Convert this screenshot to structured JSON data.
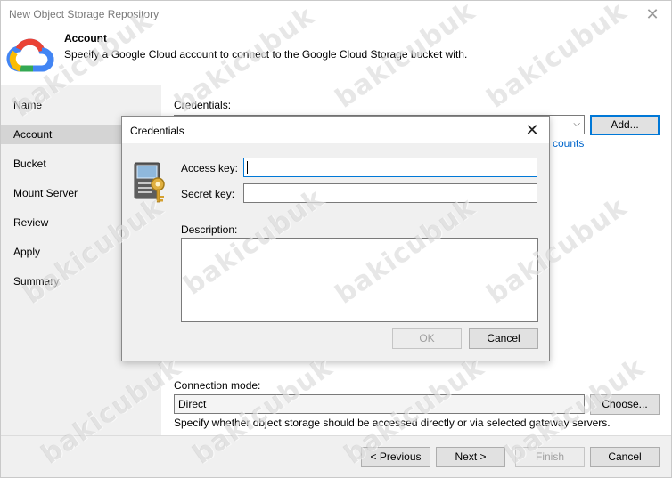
{
  "window": {
    "title": "New Object Storage Repository",
    "close_glyph": "✕"
  },
  "header": {
    "title": "Account",
    "subtitle": "Specify a Google Cloud account to connect to the Google Cloud Storage bucket with.",
    "logo_icon": "google-cloud-icon"
  },
  "sidebar": {
    "items": [
      {
        "label": "Name"
      },
      {
        "label": "Account"
      },
      {
        "label": "Bucket"
      },
      {
        "label": "Mount Server"
      },
      {
        "label": "Review"
      },
      {
        "label": "Apply"
      },
      {
        "label": "Summary"
      }
    ],
    "active_index": 1
  },
  "content": {
    "credentials_label": "Credentials:",
    "add_button": "Add...",
    "manage_accounts_link_partial": "counts",
    "connection_mode_label": "Connection mode:",
    "connection_mode_value": "Direct",
    "choose_button": "Choose...",
    "connection_hint": "Specify whether object storage should be accessed directly or via selected gateway servers."
  },
  "footer": {
    "previous": "< Previous",
    "next": "Next >",
    "finish": "Finish",
    "cancel": "Cancel"
  },
  "dialog": {
    "title": "Credentials",
    "close_glyph": "✕",
    "access_key_label": "Access key:",
    "access_key_value": "",
    "secret_key_label": "Secret key:",
    "secret_key_value": "",
    "description_label": "Description:",
    "description_value": "",
    "ok_button": "OK",
    "cancel_button": "Cancel"
  },
  "watermark": {
    "text": "bakicubuk"
  },
  "colors": {
    "accent": "#0078d7",
    "link": "#0066cc",
    "sidebar_bg": "#f0f0f0",
    "active_nav": "#d4d4d4"
  }
}
